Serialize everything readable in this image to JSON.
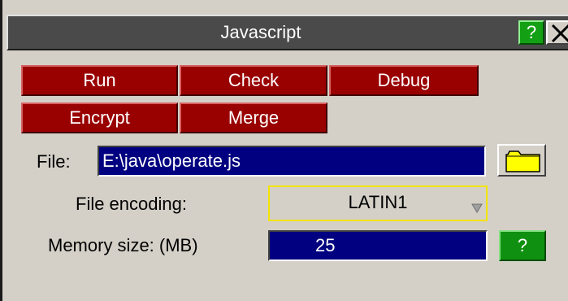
{
  "window": {
    "title": "Javascript",
    "help_label": "?"
  },
  "buttons": {
    "run": "Run",
    "check": "Check",
    "debug": "Debug",
    "encrypt": "Encrypt",
    "merge": "Merge"
  },
  "file": {
    "label": "File:",
    "value": "E:\\java\\operate.js",
    "browse_icon": "folder-icon"
  },
  "encoding": {
    "label": "File encoding:",
    "value": "LATIN1",
    "icon": "dropdown-arrow-icon"
  },
  "memory": {
    "label": "Memory size: (MB)",
    "value": "25",
    "help_label": "?"
  },
  "colors": {
    "title_bar": "#4a4a4a",
    "button_red": "#990000",
    "field_blue": "#000080",
    "help_green": "#109010",
    "select_border": "#f2e400",
    "folder_yellow": "#ffff00"
  }
}
